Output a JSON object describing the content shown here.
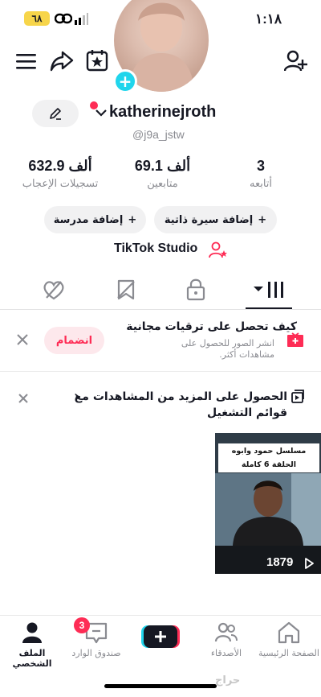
{
  "status_bar": {
    "time": "١:١٨",
    "battery": "٦٨"
  },
  "profile": {
    "username": "katherinejroth",
    "handle": "@j9a_jstw",
    "studio_label": "TikTok Studio"
  },
  "stats": [
    {
      "value": "632.9 ألف",
      "label": "تسجيلات الإعجاب"
    },
    {
      "value": "69.1 ألف",
      "label": "متابعين"
    },
    {
      "value": "3",
      "label": "أتابعه"
    }
  ],
  "buttons": {
    "add_school": "إضافة مدرسة",
    "add_bio": "إضافة سيرة ذاتية"
  },
  "promo": {
    "title": "كيف تحصل على ترقيات مجانية",
    "subtitle": "انشر الصور للحصول على مشاهدات أكثر.",
    "join_label": "انضمام"
  },
  "playlist_banner": {
    "text": "الحصول على المزيد من المشاهدات مع قوائم التشغيل",
    "chevron": "›"
  },
  "video": {
    "caption": "مسلسل حمود وابوه الحلقة 6 كاملة",
    "views": "1879"
  },
  "bottom_nav": {
    "home": "الصفحة الرئيسية",
    "friends": "الأصدقاء",
    "inbox": "صندوق الوارد",
    "inbox_badge": "3",
    "profile": "الملف الشخصي"
  },
  "watermark": "حراج",
  "colors": {
    "accent": "#fe2c55",
    "cyan": "#20d5ec",
    "text": "#161823",
    "muted": "#8a8b91"
  }
}
